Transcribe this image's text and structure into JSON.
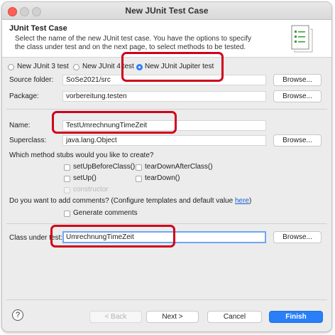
{
  "window": {
    "title": "New JUnit Test Case"
  },
  "header": {
    "title": "JUnit Test Case",
    "description": "Select the name of the new JUnit test case. You have the options to specify the class under test and on the next page, to select methods to be tested."
  },
  "version": {
    "options": [
      {
        "label": "New JUnit 3 test",
        "selected": false
      },
      {
        "label": "New JUnit 4 test",
        "selected": false
      },
      {
        "label": "New JUnit Jupiter test",
        "selected": true
      }
    ]
  },
  "source_folder": {
    "label": "Source folder:",
    "value": "SoSe2021/src",
    "browse": "Browse..."
  },
  "package": {
    "label": "Package:",
    "value": "vorbereitung.testen",
    "browse": "Browse..."
  },
  "name": {
    "label": "Name:",
    "value": "TestUmrechnungTimeZeit"
  },
  "superclass": {
    "label": "Superclass:",
    "value": "java.lang.Object",
    "browse": "Browse..."
  },
  "stubs": {
    "question": "Which method stubs would you like to create?",
    "items": [
      {
        "label": "setUpBeforeClass()",
        "checked": false,
        "enabled": true
      },
      {
        "label": "tearDownAfterClass()",
        "checked": false,
        "enabled": true
      },
      {
        "label": "setUp()",
        "checked": false,
        "enabled": true
      },
      {
        "label": "tearDown()",
        "checked": false,
        "enabled": true
      },
      {
        "label": "constructor",
        "checked": false,
        "enabled": false
      }
    ]
  },
  "comments": {
    "question": "Do you want to add comments? (Configure templates and default value ",
    "link": "here",
    "close": ")",
    "generate_label": "Generate comments",
    "checked": false
  },
  "class_under_test": {
    "label": "Class under test:",
    "value": "UmrechnungTimeZeit",
    "browse": "Browse..."
  },
  "footer": {
    "help": "?",
    "back": "< Back",
    "next": "Next >",
    "cancel": "Cancel",
    "finish": "Finish"
  },
  "colors": {
    "highlight": "#d0021b",
    "accent": "#2a7ef8",
    "link": "#1a5fd0"
  }
}
